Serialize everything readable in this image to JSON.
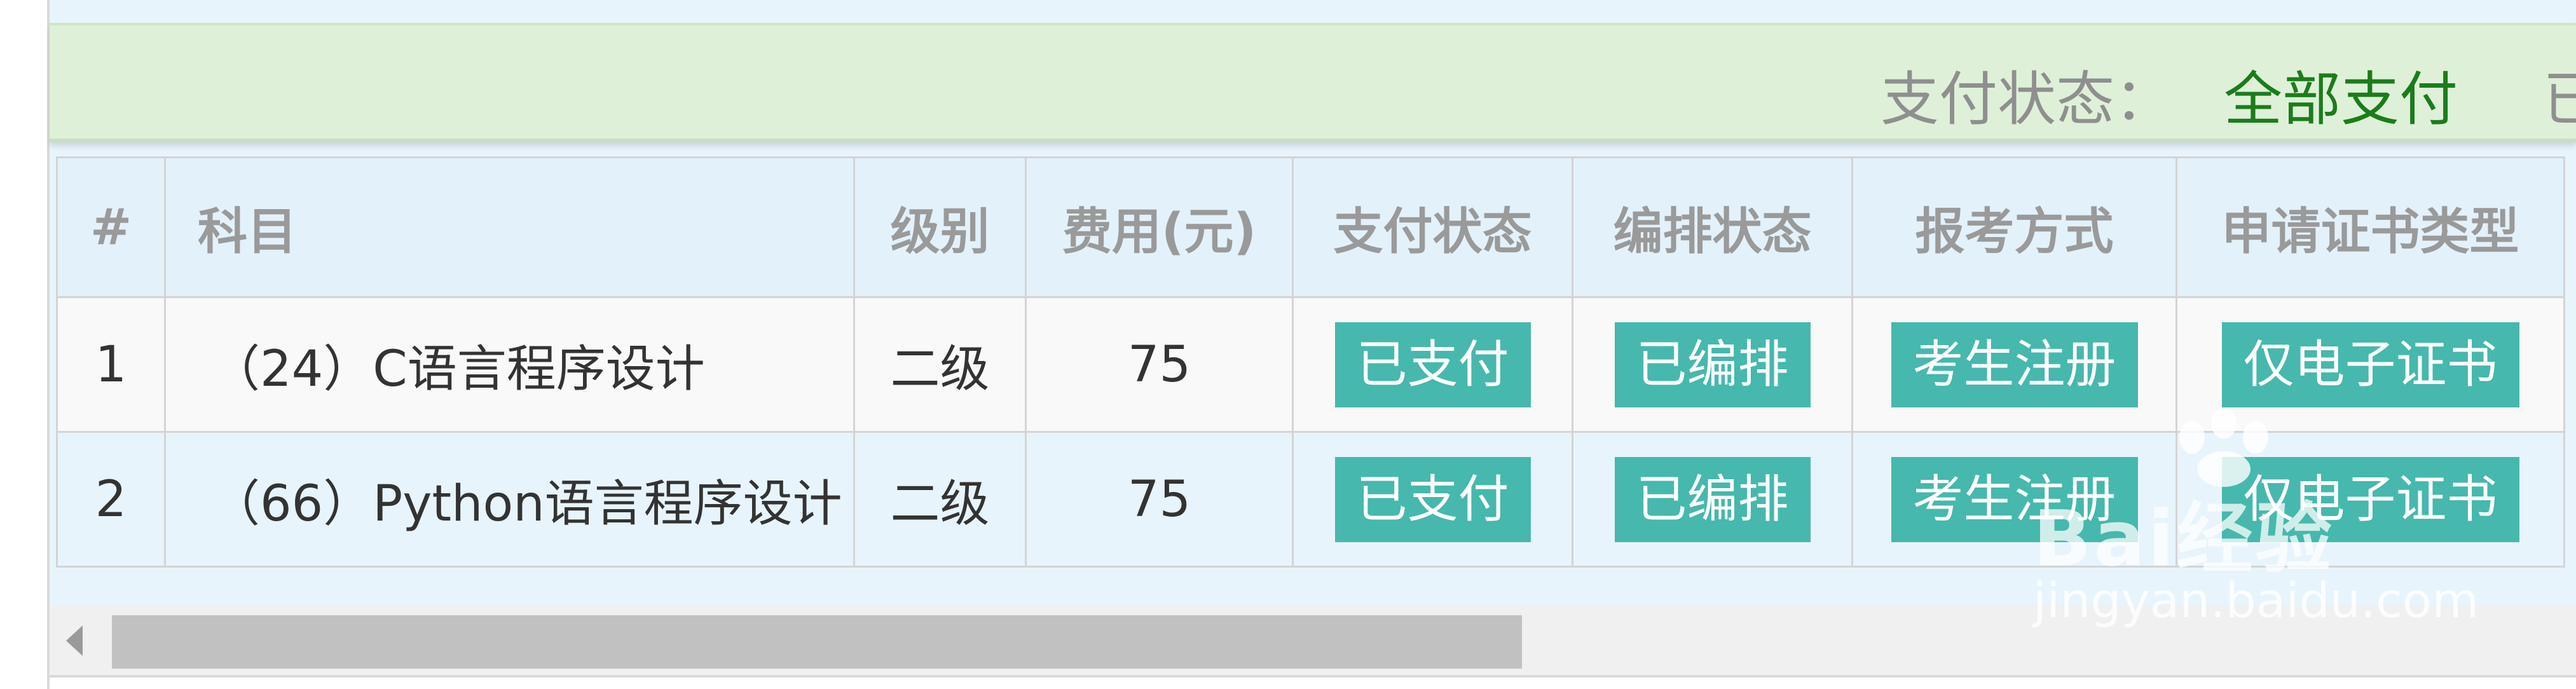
{
  "filter": {
    "label": "支付状态：",
    "value": "全部支付",
    "next_partial": "已"
  },
  "table": {
    "headers": {
      "index": "#",
      "subject": "科目",
      "level": "级别",
      "fee": "费用(元)",
      "pay_status": "支付状态",
      "arrange_status": "编排状态",
      "register_method": "报考方式",
      "certificate_type": "申请证书类型"
    },
    "rows": [
      {
        "index": "1",
        "subject": "（24）C语言程序设计",
        "level": "二级",
        "fee": "75",
        "pay_status": "已支付",
        "arrange_status": "已编排",
        "register_method": "考生注册",
        "certificate_type": "仅电子证书"
      },
      {
        "index": "2",
        "subject": "（66）Python语言程序设计",
        "level": "二级",
        "fee": "75",
        "pay_status": "已支付",
        "arrange_status": "已编排",
        "register_method": "考生注册",
        "certificate_type": "仅电子证书"
      }
    ]
  },
  "scrollbar": {
    "horizontal_position": 0.0
  },
  "watermark": {
    "brand": "Bai经验",
    "url": "jingyan.baidu.com"
  },
  "colors": {
    "status_pill": "#46b8ad",
    "filter_value": "#1a7d1a",
    "filter_bar": "#dff0d8"
  }
}
